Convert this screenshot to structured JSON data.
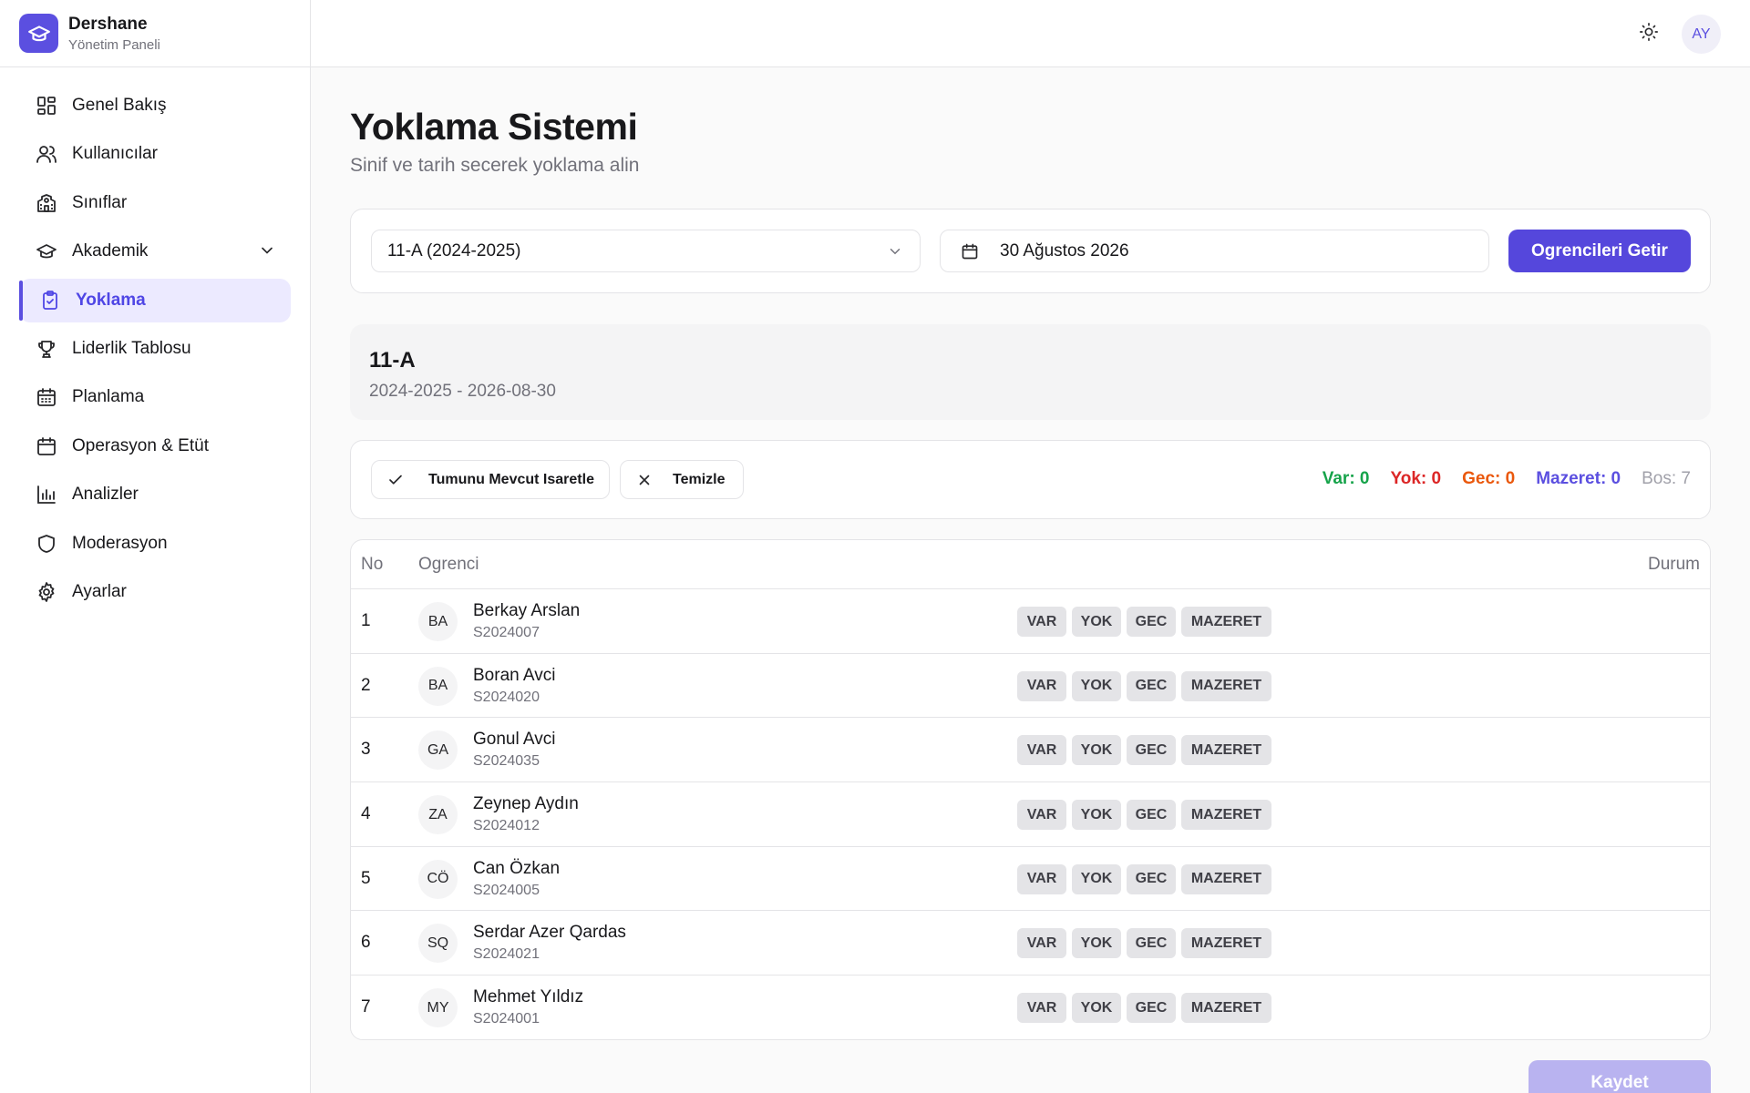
{
  "brand": {
    "title": "Dershane",
    "subtitle": "Yönetim Paneli"
  },
  "topbar": {
    "avatar_initials": "AY",
    "theme_icon": "sun-icon"
  },
  "sidebar": {
    "items": [
      {
        "label": "Genel Bakış",
        "icon": "dashboard-icon"
      },
      {
        "label": "Kullanıcılar",
        "icon": "users-icon"
      },
      {
        "label": "Sınıflar",
        "icon": "school-icon"
      },
      {
        "label": "Akademik",
        "icon": "graduation-cap-icon"
      },
      {
        "label": "Yoklama",
        "icon": "clipboard-check-icon"
      },
      {
        "label": "Liderlik Tablosu",
        "icon": "trophy-icon"
      },
      {
        "label": "Planlama",
        "icon": "calendar-grid-icon"
      },
      {
        "label": "Operasyon & Etüt",
        "icon": "calendar-icon"
      },
      {
        "label": "Analizler",
        "icon": "bar-chart-icon"
      },
      {
        "label": "Moderasyon",
        "icon": "shield-icon"
      },
      {
        "label": "Ayarlar",
        "icon": "gear-icon"
      }
    ],
    "active_index": 4
  },
  "page": {
    "title": "Yoklama Sistemi",
    "subtitle": "Sinif ve tarih secerek yoklama alin"
  },
  "filters": {
    "class_value": "11-A (2024-2025)",
    "date_value": "30 Ağustos 2026",
    "fetch_label": "Ogrencileri Getir"
  },
  "class_info": {
    "name": "11-A",
    "meta": "2024-2025 - 2026-08-30"
  },
  "actions": {
    "mark_all_label": "Tumunu Mevcut Isaretle",
    "clear_label": "Temizle"
  },
  "stats": {
    "var": "Var: 0",
    "yok": "Yok: 0",
    "gec": "Gec: 0",
    "mazeret": "Mazeret: 0",
    "bos": "Bos: 7"
  },
  "colors": {
    "accent": "#5547dc",
    "var": "#16a34a",
    "yok": "#dc2626",
    "gec": "#ea580c",
    "mazeret": "#5b4fe0"
  },
  "table": {
    "headers": {
      "no": "No",
      "student": "Ogrenci",
      "status": "Durum"
    },
    "status_labels": {
      "var": "VAR",
      "yok": "YOK",
      "gec": "GEC",
      "mazeret": "MAZERET"
    },
    "rows": [
      {
        "no": "1",
        "initials": "BA",
        "name": "Berkay Arslan",
        "id": "S2024007"
      },
      {
        "no": "2",
        "initials": "BA",
        "name": "Boran Avci",
        "id": "S2024020"
      },
      {
        "no": "3",
        "initials": "GA",
        "name": "Gonul Avci",
        "id": "S2024035"
      },
      {
        "no": "4",
        "initials": "ZA",
        "name": "Zeynep Aydın",
        "id": "S2024012"
      },
      {
        "no": "5",
        "initials": "CÖ",
        "name": "Can Özkan",
        "id": "S2024005"
      },
      {
        "no": "6",
        "initials": "SQ",
        "name": "Serdar Azer Qardas",
        "id": "S2024021"
      },
      {
        "no": "7",
        "initials": "MY",
        "name": "Mehmet Yıldız",
        "id": "S2024001"
      }
    ]
  },
  "save_label": "Kaydet"
}
